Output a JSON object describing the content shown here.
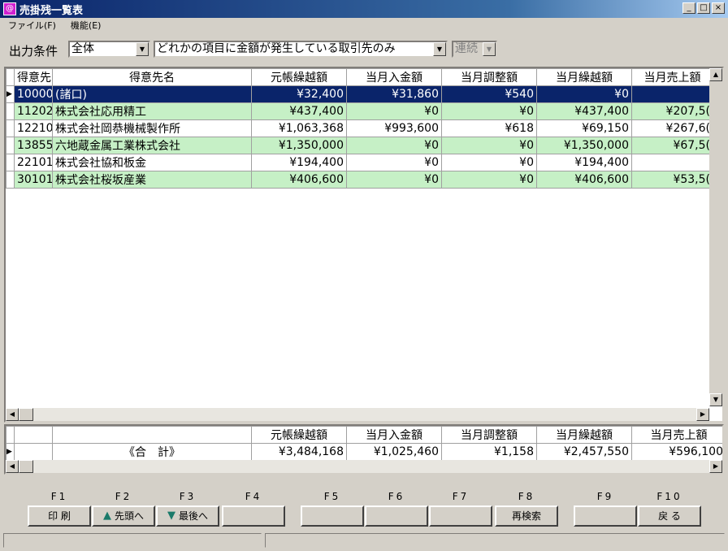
{
  "window": {
    "title": "売掛残一覧表"
  },
  "menu": [
    "ファイル(F)",
    "機能(E)"
  ],
  "filter": {
    "label": "出力条件",
    "scope": "全体",
    "condition": "どれかの項目に金額が発生している取引先のみ",
    "link": "連続"
  },
  "columns": [
    "得意先",
    "得意先名",
    "元帳繰越額",
    "当月入金額",
    "当月調整額",
    "当月繰越額",
    "当月売上額"
  ],
  "rows": [
    {
      "code": "10000",
      "name": "(諸口)",
      "v1": "¥32,400",
      "v2": "¥31,860",
      "v3": "¥540",
      "v4": "¥0",
      "v5": "",
      "state": "sel"
    },
    {
      "code": "11202",
      "name": "株式会社応用精工",
      "v1": "¥437,400",
      "v2": "¥0",
      "v3": "¥0",
      "v4": "¥437,400",
      "v5": "¥207,5(",
      "state": "green"
    },
    {
      "code": "12210",
      "name": "株式会社岡恭機械製作所",
      "v1": "¥1,063,368",
      "v2": "¥993,600",
      "v3": "¥618",
      "v4": "¥69,150",
      "v5": "¥267,6(",
      "state": "white"
    },
    {
      "code": "13855",
      "name": "六地蔵金属工業株式会社",
      "v1": "¥1,350,000",
      "v2": "¥0",
      "v3": "¥0",
      "v4": "¥1,350,000",
      "v5": "¥67,5(",
      "state": "green"
    },
    {
      "code": "22101",
      "name": "株式会社協和板金",
      "v1": "¥194,400",
      "v2": "¥0",
      "v3": "¥0",
      "v4": "¥194,400",
      "v5": "",
      "state": "white"
    },
    {
      "code": "30101",
      "name": "株式会社桜坂産業",
      "v1": "¥406,600",
      "v2": "¥0",
      "v3": "¥0",
      "v4": "¥406,600",
      "v5": "¥53,5(",
      "state": "green"
    }
  ],
  "totals": {
    "columns": [
      "",
      "",
      "元帳繰越額",
      "当月入金額",
      "当月調整額",
      "当月繰越額",
      "当月売上額"
    ],
    "label": "《合　計》",
    "v1": "¥3,484,168",
    "v2": "¥1,025,460",
    "v3": "¥1,158",
    "v4": "¥2,457,550",
    "v5": "¥596,100"
  },
  "fkeys": [
    {
      "key": "F1",
      "label": "印 刷",
      "icon": ""
    },
    {
      "key": "F2",
      "label": "先頭へ",
      "icon": "arrow-up-icon"
    },
    {
      "key": "F3",
      "label": "最後へ",
      "icon": "arrow-down-icon"
    },
    {
      "key": "F4",
      "label": "",
      "icon": ""
    },
    {
      "key": "F5",
      "label": "",
      "icon": ""
    },
    {
      "key": "F6",
      "label": "",
      "icon": ""
    },
    {
      "key": "F7",
      "label": "",
      "icon": ""
    },
    {
      "key": "F8",
      "label": "再検索",
      "icon": ""
    },
    {
      "key": "F9",
      "label": "",
      "icon": ""
    },
    {
      "key": "F10",
      "label": "戻 る",
      "icon": ""
    }
  ],
  "colors": {
    "selected": "#0a246a",
    "alt_row": "#c6f0c6",
    "arrow": "#1a7a6a"
  }
}
